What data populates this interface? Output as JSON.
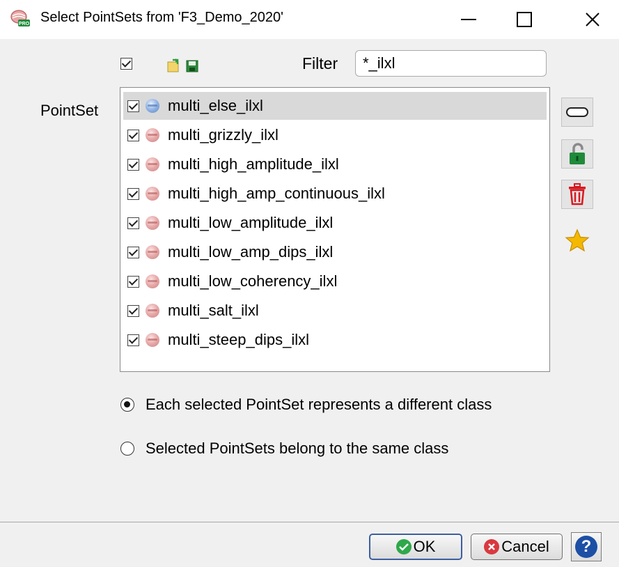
{
  "window": {
    "title": "Select PointSets from 'F3_Demo_2020'",
    "app_icon": "opendtect-pro-icon",
    "controls": [
      "minimize-icon",
      "maximize-icon",
      "close-icon"
    ]
  },
  "toolbar": {
    "select_all_checked": true,
    "icons": [
      "open-icon",
      "save-icon"
    ]
  },
  "filter": {
    "label": "Filter",
    "value": "*_ilxl"
  },
  "pointset": {
    "label": "PointSet",
    "items": [
      {
        "label": "multi_else_ilxl",
        "checked": true,
        "selected": true
      },
      {
        "label": "multi_grizzly_ilxl",
        "checked": true,
        "selected": false
      },
      {
        "label": "multi_high_amplitude_ilxl",
        "checked": true,
        "selected": false
      },
      {
        "label": "multi_high_amp_continuous_ilxl",
        "checked": true,
        "selected": false
      },
      {
        "label": "multi_low_amplitude_ilxl",
        "checked": true,
        "selected": false
      },
      {
        "label": "multi_low_amp_dips_ilxl",
        "checked": true,
        "selected": false
      },
      {
        "label": "multi_low_coherency_ilxl",
        "checked": true,
        "selected": false
      },
      {
        "label": "multi_salt_ilxl",
        "checked": true,
        "selected": false
      },
      {
        "label": "multi_steep_dips_ilxl",
        "checked": true,
        "selected": false
      }
    ]
  },
  "side_buttons": [
    "rename-icon",
    "unlock-icon",
    "delete-icon",
    "favorite-icon"
  ],
  "options": {
    "different_class": "Each selected PointSet represents a different class",
    "same_class": "Selected PointSets belong to the same class",
    "selected": "different_class"
  },
  "buttons": {
    "ok": "OK",
    "cancel": "Cancel",
    "help": "?"
  },
  "colors": {
    "ok_icon": "#2ea84a",
    "cancel_icon": "#d9393f",
    "help": "#1d4fa5",
    "delete": "#d71920",
    "favorite": "#f5b800"
  }
}
